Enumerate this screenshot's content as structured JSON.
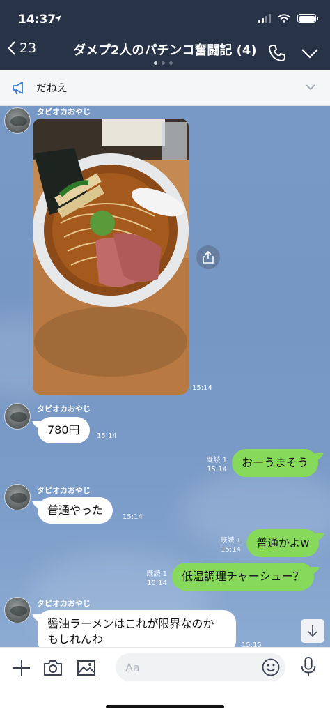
{
  "status": {
    "time": "14:37"
  },
  "header": {
    "back_label": "23",
    "title": "ダメプ2人のパチンコ奮闘記 (4)"
  },
  "notice": {
    "text": "だねえ"
  },
  "messages": {
    "sender_name": "タピオカおやじ",
    "photo": {
      "time": "15:14"
    },
    "m1": {
      "text": "780円",
      "time": "15:14"
    },
    "m2": {
      "read": "既読 1",
      "time": "15:14",
      "text": "おーうまそう"
    },
    "m3": {
      "text": "普通やった",
      "time": "15:14"
    },
    "m4": {
      "read": "既読 1",
      "time": "15:14",
      "text": "普通かよw"
    },
    "m5": {
      "read": "既読 1",
      "time": "15:14",
      "text": "低温調理チャーシュー？"
    },
    "m6": {
      "line1": "醤油ラーメンはこれが限界なのか",
      "line2": "もしれんわ",
      "time": "15:15"
    }
  },
  "input": {
    "placeholder": "Aa"
  },
  "icons": {
    "back": "chevron-left-icon",
    "call": "phone-icon",
    "menu": "chevron-down-icon",
    "notice": "megaphone-icon",
    "share": "share-icon",
    "scroll": "arrow-down-icon",
    "add": "plus-icon",
    "camera": "camera-icon",
    "image": "image-icon",
    "emoji": "smiley-icon",
    "mic": "microphone-icon"
  },
  "colors": {
    "header_bg": "#283347",
    "chat_bg": "#7898c6",
    "outgoing_bubble": "#86d95a",
    "incoming_bubble": "#ffffff"
  }
}
